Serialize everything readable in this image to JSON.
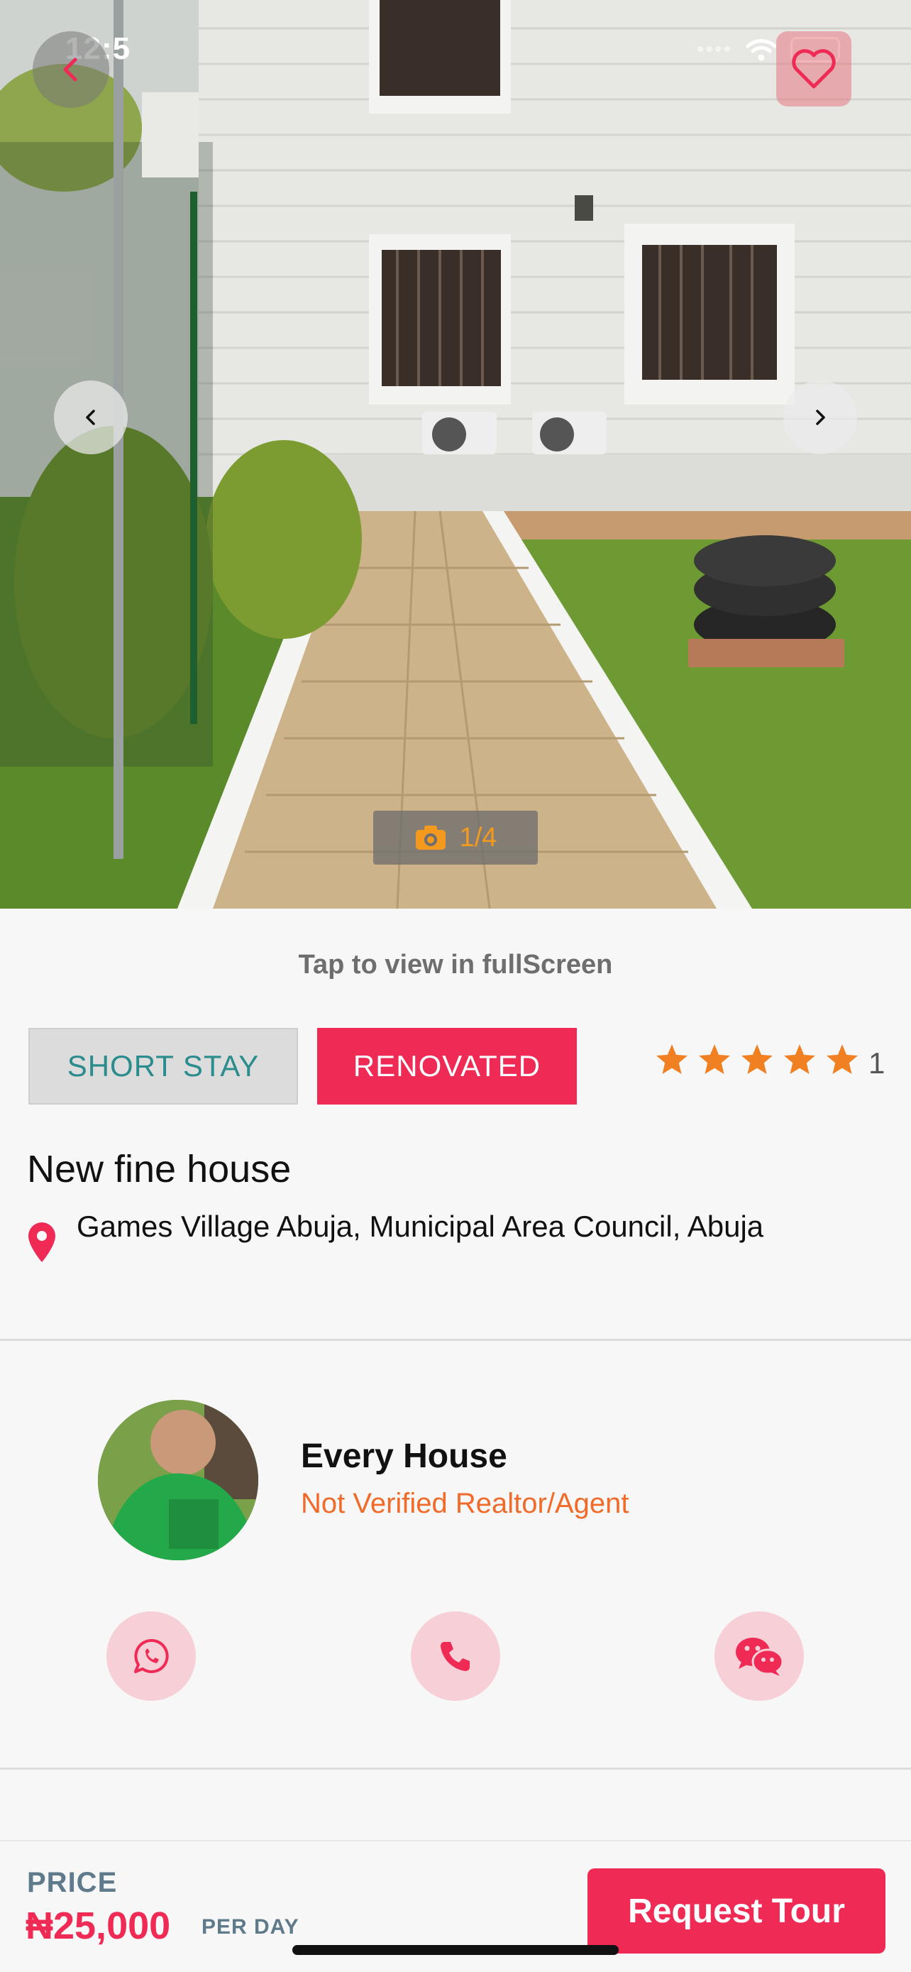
{
  "status_bar": {
    "time": "12:5"
  },
  "gallery": {
    "counter": "1/4"
  },
  "tap_hint": "Tap to view in fullScreen",
  "tags": {
    "short_stay": "SHORT STAY",
    "renovated": "RENOVATED"
  },
  "rating": {
    "stars": 5,
    "count": "1",
    "star_color": "#f08022"
  },
  "listing": {
    "title": "New fine house",
    "address": "Games Village Abuja, Municipal Area Council, Abuja"
  },
  "agent": {
    "name": "Every House",
    "status": "Not Verified Realtor/Agent"
  },
  "contacts": [
    "whatsapp-icon",
    "phone-icon",
    "wechat-icon"
  ],
  "price": {
    "label": "PRICE",
    "value": "₦25,000",
    "unit": "PER DAY"
  },
  "cta": {
    "label": "Request Tour"
  },
  "colors": {
    "accent": "#ee2a55",
    "agent_status": "#f06b2a",
    "teal": "#2a8c8c"
  }
}
